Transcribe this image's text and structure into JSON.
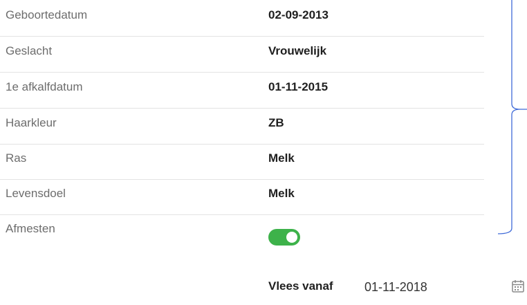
{
  "fields": [
    {
      "label": "Geboortedatum",
      "value": "02-09-2013"
    },
    {
      "label": "Geslacht",
      "value": "Vrouwelijk"
    },
    {
      "label": "1e afkalfdatum",
      "value": "01-11-2015"
    },
    {
      "label": "Haarkleur",
      "value": "ZB"
    },
    {
      "label": "Ras",
      "value": "Melk"
    },
    {
      "label": "Levensdoel",
      "value": "Melk"
    }
  ],
  "afmesten": {
    "label": "Afmesten",
    "enabled": true,
    "toggle_color": "#3db24a"
  },
  "vlees_vanaf": {
    "label": "Vlees vanaf",
    "value": "01-11-2018"
  },
  "icons": {
    "calendar": "calendar-icon"
  },
  "colors": {
    "brace": "#3f6ad8",
    "label_text": "#6d6d6d"
  }
}
